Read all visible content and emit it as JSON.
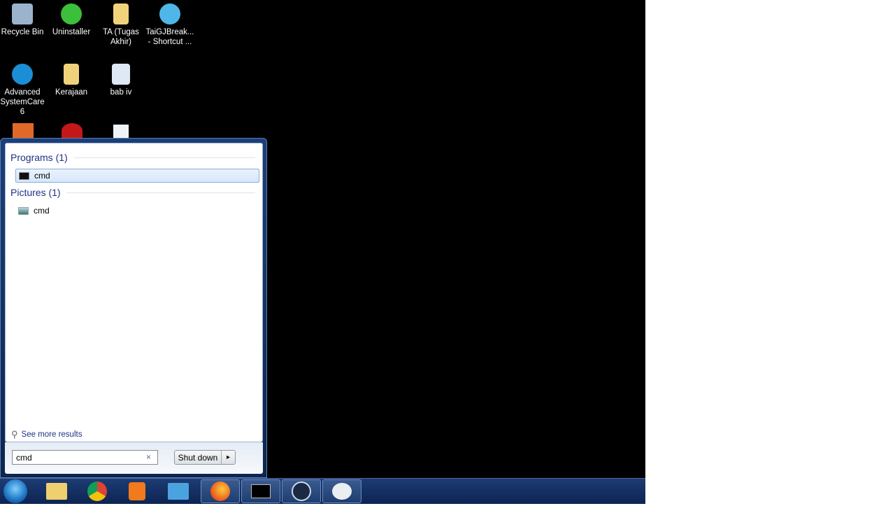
{
  "desktop": {
    "icons": [
      {
        "label": "Recycle Bin",
        "icon": "recycle-bin-icon",
        "color": "#9bb4cc"
      },
      {
        "label": "Uninstaller",
        "icon": "uninstaller-icon",
        "color": "#3cbf3a"
      },
      {
        "label": "TA (Tugas Akhir)",
        "icon": "folder-icon",
        "color": "#f0d27a"
      },
      {
        "label": "TaiGJBreak... - Shortcut ...",
        "icon": "shortcut-icon",
        "color": "#4fb7e8"
      },
      {
        "label": "Advanced SystemCare 6",
        "icon": "advanced-systemcare-icon",
        "color": "#1a8fd6"
      },
      {
        "label": "Kerajaan",
        "icon": "folder-icon",
        "color": "#f0d27a"
      },
      {
        "label": "bab iv",
        "icon": "word-document-icon",
        "color": "#dfe8f5"
      }
    ]
  },
  "start_menu": {
    "groups": [
      {
        "title": "Programs (1)",
        "items": [
          {
            "label": "cmd",
            "icon": "cmd-icon",
            "selected": true
          }
        ]
      },
      {
        "title": "Pictures (1)",
        "items": [
          {
            "label": "cmd",
            "icon": "picture-icon",
            "selected": false
          }
        ]
      }
    ],
    "see_more": "See more results",
    "search_value": "cmd",
    "clear": "×",
    "shutdown_label": "Shut down",
    "shutdown_arrow": "▸"
  },
  "taskbar": {
    "items": [
      "start-orb",
      "file-explorer",
      "chrome",
      "media-player",
      "control-panel",
      "firefox",
      "cmd",
      "steam",
      "paint"
    ]
  }
}
